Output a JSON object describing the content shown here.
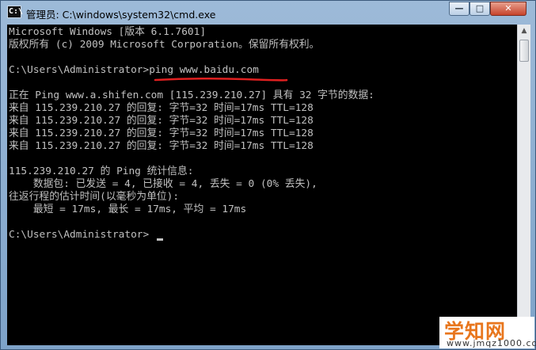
{
  "window": {
    "title": "管理员: C:\\windows\\system32\\cmd.exe",
    "icon": "cmd-icon",
    "controls": {
      "minimize_glyph": "—",
      "maximize_glyph": "□",
      "close_glyph": "✕"
    }
  },
  "console": {
    "lines": [
      "Microsoft Windows [版本 6.1.7601]",
      "版权所有 (c) 2009 Microsoft Corporation。保留所有权利。",
      "",
      "C:\\Users\\Administrator>ping www.baidu.com",
      "",
      "正在 Ping www.a.shifen.com [115.239.210.27] 具有 32 字节的数据:",
      "来自 115.239.210.27 的回复: 字节=32 时间=17ms TTL=128",
      "来自 115.239.210.27 的回复: 字节=32 时间=17ms TTL=128",
      "来自 115.239.210.27 的回复: 字节=32 时间=17ms TTL=128",
      "来自 115.239.210.27 的回复: 字节=32 时间=17ms TTL=128",
      "",
      "115.239.210.27 的 Ping 统计信息:",
      "    数据包: 已发送 = 4, 已接收 = 4, 丢失 = 0 (0% 丢失),",
      "往返行程的估计时间(以毫秒为单位):",
      "    最短 = 17ms, 最长 = 17ms, 平均 = 17ms",
      "",
      "C:\\Users\\Administrator>"
    ],
    "text_color": "#c0c0c0",
    "background": "#000000",
    "annotation_color": "#e02020"
  },
  "watermark": {
    "main": "学知网",
    "url": "www.jmqz1000.com"
  }
}
